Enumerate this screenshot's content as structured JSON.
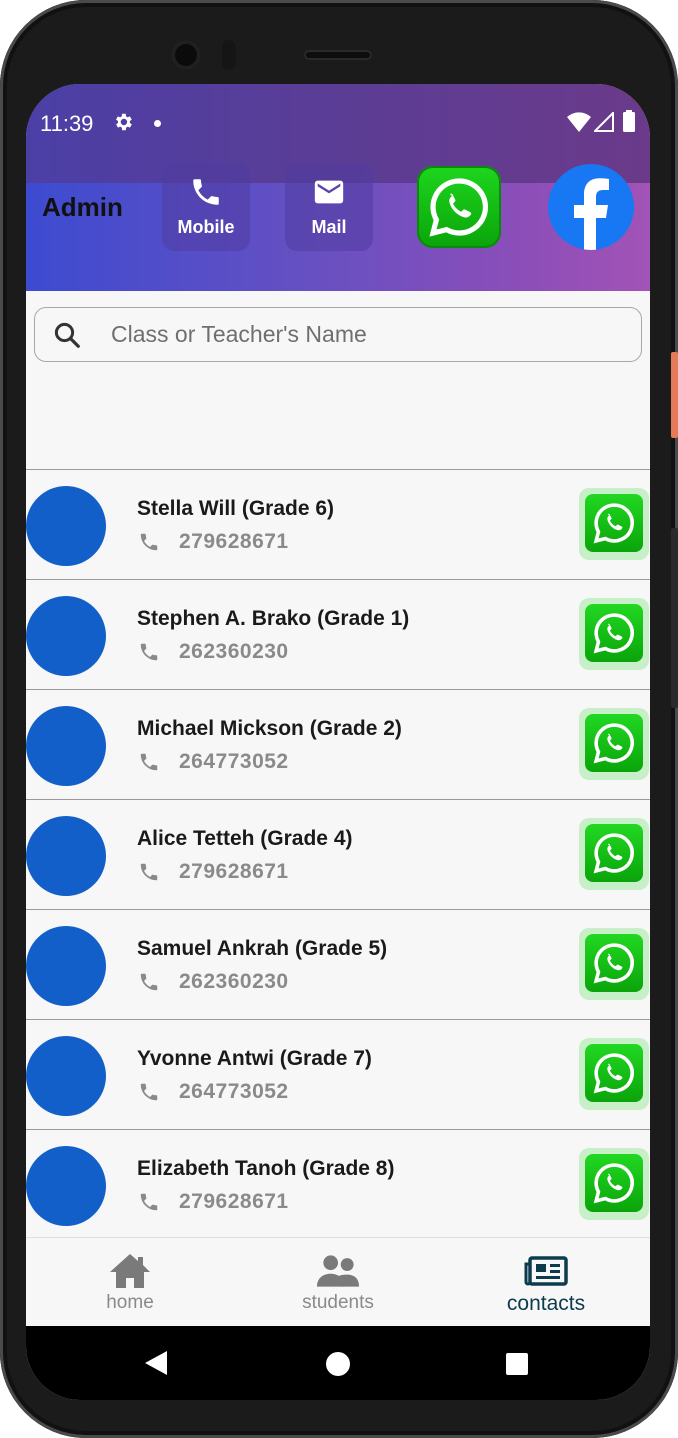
{
  "status": {
    "time": "11:39"
  },
  "header": {
    "title": "Admin",
    "buttons": [
      {
        "label": "Mobile",
        "icon": "phone-icon"
      },
      {
        "label": "Mail",
        "icon": "mail-icon"
      }
    ],
    "social": [
      "whatsapp-icon",
      "facebook-icon"
    ]
  },
  "search": {
    "placeholder": "Class or Teacher's Name",
    "value": ""
  },
  "contacts": [
    {
      "name": "Stella Will (Grade 6)",
      "phone": "279628671"
    },
    {
      "name": "Stephen A. Brako (Grade 1)",
      "phone": "262360230"
    },
    {
      "name": "Michael Mickson (Grade 2)",
      "phone": "264773052"
    },
    {
      "name": "Alice Tetteh (Grade 4)",
      "phone": "279628671"
    },
    {
      "name": "Samuel Ankrah (Grade 5)",
      "phone": "262360230"
    },
    {
      "name": "Yvonne Antwi (Grade 7)",
      "phone": "264773052"
    },
    {
      "name": "Elizabeth Tanoh (Grade 8)",
      "phone": "279628671"
    }
  ],
  "bottom_nav": [
    {
      "label": "home",
      "icon": "home-icon",
      "active": false
    },
    {
      "label": "students",
      "icon": "students-icon",
      "active": false
    },
    {
      "label": "contacts",
      "icon": "contacts-icon",
      "active": true
    }
  ],
  "colors": {
    "header_gradient_start": "#3d4bd0",
    "header_gradient_end": "#a253b6",
    "avatar": "#125fc9",
    "whatsapp": "#0aa40a",
    "facebook": "#1877f2",
    "active_nav": "#0c3b4d"
  }
}
